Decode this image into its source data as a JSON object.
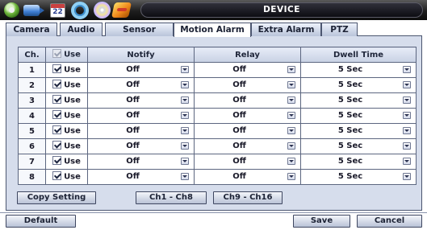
{
  "header": {
    "title": "DEVICE",
    "calendar_icon_text": "22",
    "icons": [
      "system-gear-icon",
      "camera-icon",
      "calendar-icon",
      "network-ring-icon",
      "disc-icon",
      "tools-icon"
    ]
  },
  "tabs": [
    {
      "label": "Camera",
      "active": false
    },
    {
      "label": "Audio",
      "active": false
    },
    {
      "label": "Sensor",
      "active": false
    },
    {
      "label": "Motion Alarm",
      "active": true
    },
    {
      "label": "Extra Alarm",
      "active": false
    },
    {
      "label": "PTZ",
      "active": false
    }
  ],
  "table": {
    "headers": {
      "ch": "Ch.",
      "use": "Use",
      "notify": "Notify",
      "relay": "Relay",
      "dwell": "Dwell Time"
    },
    "rows": [
      {
        "ch": "1",
        "use_checked": true,
        "use_label": "Use",
        "notify": "Off",
        "relay": "Off",
        "dwell": "5 Sec"
      },
      {
        "ch": "2",
        "use_checked": true,
        "use_label": "Use",
        "notify": "Off",
        "relay": "Off",
        "dwell": "5 Sec"
      },
      {
        "ch": "3",
        "use_checked": true,
        "use_label": "Use",
        "notify": "Off",
        "relay": "Off",
        "dwell": "5 Sec"
      },
      {
        "ch": "4",
        "use_checked": true,
        "use_label": "Use",
        "notify": "Off",
        "relay": "Off",
        "dwell": "5 Sec"
      },
      {
        "ch": "5",
        "use_checked": true,
        "use_label": "Use",
        "notify": "Off",
        "relay": "Off",
        "dwell": "5 Sec"
      },
      {
        "ch": "6",
        "use_checked": true,
        "use_label": "Use",
        "notify": "Off",
        "relay": "Off",
        "dwell": "5 Sec"
      },
      {
        "ch": "7",
        "use_checked": true,
        "use_label": "Use",
        "notify": "Off",
        "relay": "Off",
        "dwell": "5 Sec"
      },
      {
        "ch": "8",
        "use_checked": true,
        "use_label": "Use",
        "notify": "Off",
        "relay": "Off",
        "dwell": "5 Sec"
      }
    ]
  },
  "buttons": {
    "copy_setting": "Copy Setting",
    "ch_1_8": "Ch1 - Ch8",
    "ch_9_16": "Ch9 - Ch16",
    "default": "Default",
    "save": "Save",
    "cancel": "Cancel"
  }
}
